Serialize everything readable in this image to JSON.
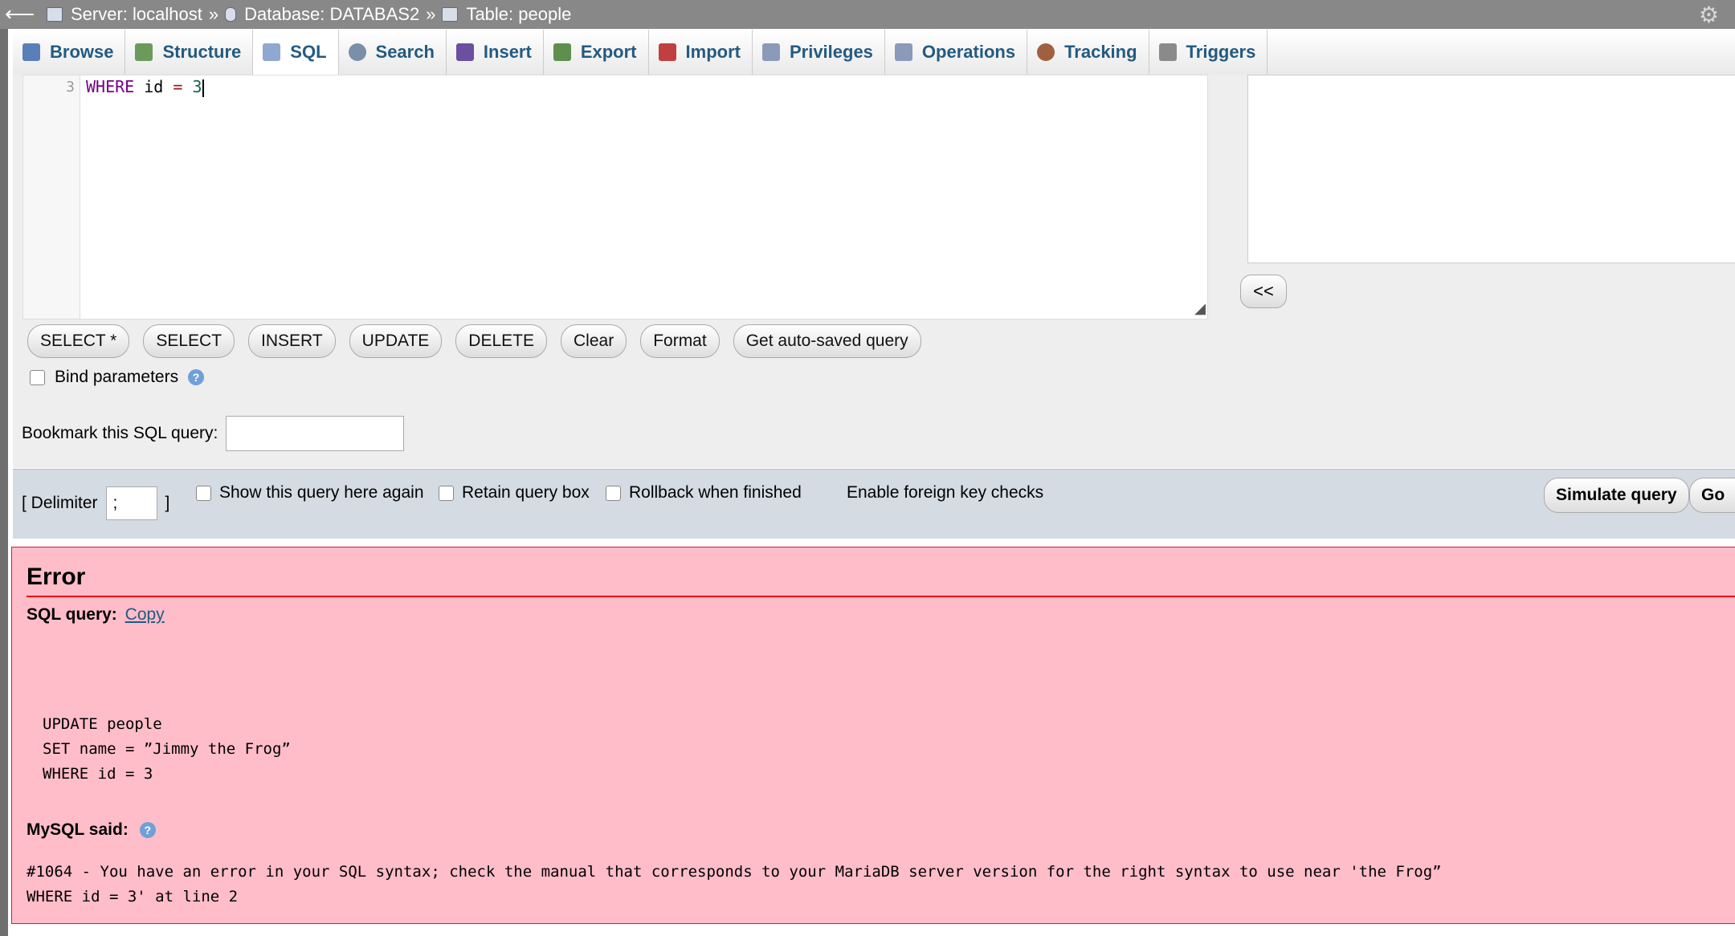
{
  "breadcrumb": {
    "back_glyph": "⟵",
    "server": "Server: localhost",
    "database": "Database: DATABAS2",
    "table": "Table: people",
    "separator": "»"
  },
  "tabs": [
    {
      "label": "Browse",
      "icon": "browse-icon",
      "color": "#5a7fb8"
    },
    {
      "label": "Structure",
      "icon": "structure-icon",
      "color": "#6a9b5a"
    },
    {
      "label": "SQL",
      "icon": "sql-icon",
      "color": "#8fa8d0"
    },
    {
      "label": "Search",
      "icon": "search-icon",
      "color": "#7a8fa8"
    },
    {
      "label": "Insert",
      "icon": "insert-icon",
      "color": "#6b4fa0"
    },
    {
      "label": "Export",
      "icon": "export-icon",
      "color": "#5f8f4f"
    },
    {
      "label": "Import",
      "icon": "import-icon",
      "color": "#c04040"
    },
    {
      "label": "Privileges",
      "icon": "privileges-icon",
      "color": "#8a9ab8"
    },
    {
      "label": "Operations",
      "icon": "operations-icon",
      "color": "#8a9ab8"
    },
    {
      "label": "Tracking",
      "icon": "tracking-icon",
      "color": "#a06040"
    },
    {
      "label": "Triggers",
      "icon": "triggers-icon",
      "color": "#8a8a8a"
    }
  ],
  "active_tab": "SQL",
  "editor": {
    "line_number": "3",
    "kw": "WHERE",
    "ident": "id",
    "op": "=",
    "num": "3"
  },
  "collapse_label": "<<",
  "query_buttons": [
    "SELECT *",
    "SELECT",
    "INSERT",
    "UPDATE",
    "DELETE",
    "Clear",
    "Format",
    "Get auto-saved query"
  ],
  "bind_params_label": "Bind parameters",
  "bookmark_label": "Bookmark this SQL query:",
  "options": {
    "delimiter_open": "[ Delimiter",
    "delimiter_value": ";",
    "delimiter_close": "]",
    "show_again": "Show this query here again",
    "retain_box": "Retain query box",
    "rollback": "Rollback when finished",
    "fk_checks": "Enable foreign key checks",
    "simulate": "Simulate query",
    "go": "Go"
  },
  "error": {
    "title": "Error",
    "sql_query_label": "SQL query:",
    "copy_link": "Copy",
    "query_lines": [
      "UPDATE people",
      "SET name = ”Jimmy the Frog”",
      "WHERE id = 3"
    ],
    "mysql_said_label": "MySQL said:",
    "message_lines": [
      "#1064 - You have an error in your SQL syntax; check the manual that corresponds to your MariaDB server version for the right syntax to use near 'the Frog”",
      "WHERE id = 3' at line 2"
    ]
  }
}
